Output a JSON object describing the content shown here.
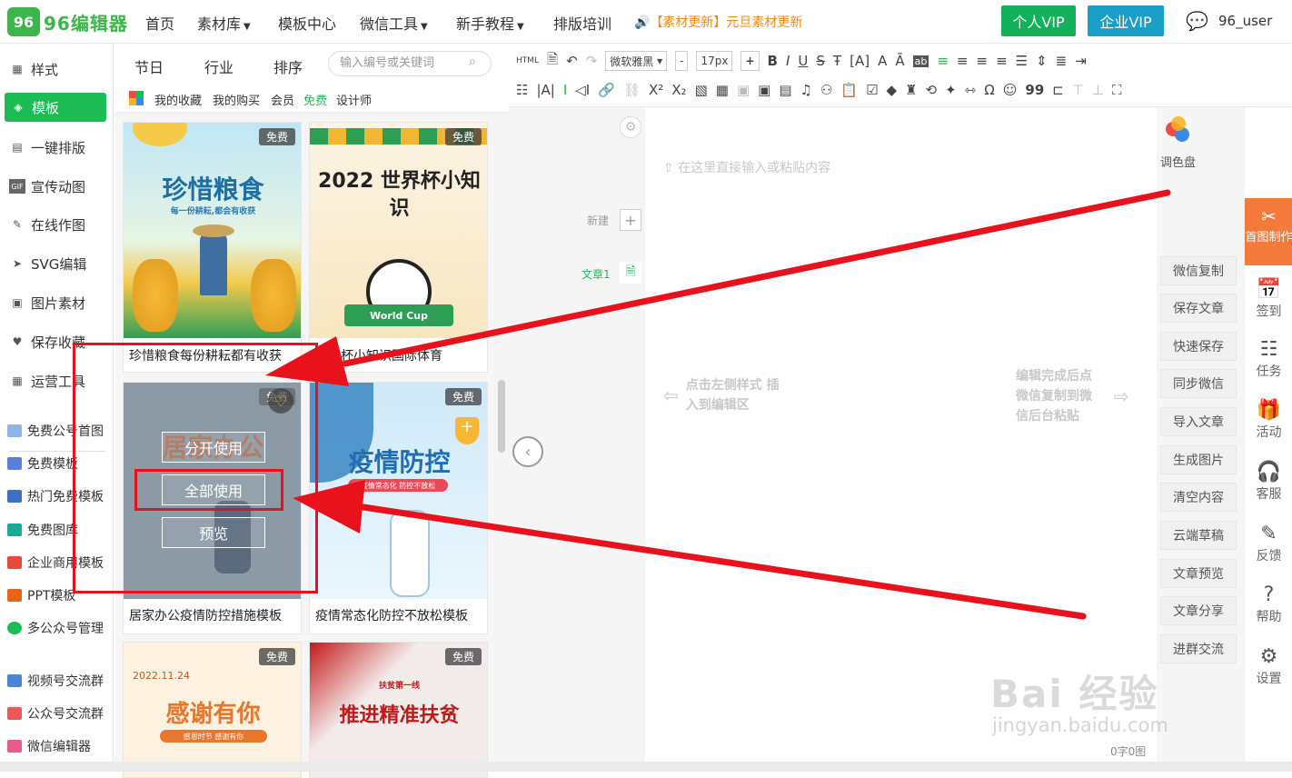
{
  "nav": {
    "logo_mark": "96",
    "logo_text": "96编辑器",
    "items": [
      "首页",
      "素材库",
      "模板中心",
      "微信工具",
      "新手教程",
      "排版培训"
    ],
    "notice": "【素材更新】元旦素材更新",
    "vip_personal": "个人VIP",
    "vip_business": "企业VIP",
    "username": "96_user"
  },
  "sidebar": {
    "primary": [
      "样式",
      "模板",
      "一键排版",
      "宣传动图",
      "在线作图",
      "SVG编辑",
      "图片素材",
      "保存收藏",
      "运营工具"
    ],
    "active": "模板",
    "secondary": [
      "免费公号首图",
      "免费模板",
      "热门免费模板",
      "免费图库",
      "企业商用模板",
      "PPT模板",
      "多公众号管理"
    ],
    "groups": [
      "视频号交流群",
      "公众号交流群",
      "微信编辑器"
    ]
  },
  "panel": {
    "tabs": [
      "节日",
      "行业",
      "排序"
    ],
    "search_placeholder": "输入编号或关键词",
    "filters": [
      "我的收藏",
      "我的购买",
      "会员",
      "免费",
      "设计师"
    ],
    "active_filter": "免费",
    "cards": [
      {
        "badge": "免费",
        "title": "珍惜粮食",
        "subtitle": "每一份耕耘,都会有收获",
        "caption": "珍惜粮食每份耕耘都有收获"
      },
      {
        "badge": "免费",
        "title": "2022 世界杯小知识",
        "subtitle": "World Cup",
        "caption": "世界杯小知识国际体育"
      },
      {
        "badge": "免费",
        "title": "居家办公",
        "caption": "居家办公疫情防控措施模板"
      },
      {
        "badge": "免费",
        "title": "疫情防控",
        "subtitle": "疫情常态化 防控不放松",
        "caption": "疫情常态化防控不放松模板"
      },
      {
        "badge": "免费",
        "title": "感谢有你",
        "date": "2022.11.24",
        "subtitle": "感恩时节 感谢有你"
      },
      {
        "badge": "免费",
        "title": "推进精准扶贫",
        "subtitle": "扶贫第一线"
      }
    ],
    "hover_actions": [
      "分开使用",
      "全部使用",
      "预览"
    ]
  },
  "editor": {
    "font": "微软雅黑",
    "font_size": "17px",
    "placeholder": "在这里直接输入或粘贴内容",
    "new_label": "新建",
    "article_label": "文章1",
    "hint_left": "点击左侧样式 插入到编辑区",
    "hint_right": "编辑完成后点 微信复制到微 信后台粘贴",
    "counter": "0字0图",
    "palette_label": "调色盘",
    "right_buttons": [
      "微信复制",
      "保存文章",
      "快速保存",
      "同步微信",
      "导入文章",
      "生成图片",
      "清空内容",
      "云端草稿",
      "文章预览",
      "文章分享",
      "进群交流"
    ],
    "far_right": [
      "首图制作",
      "签到",
      "任务",
      "活动",
      "客服",
      "反馈",
      "帮助",
      "设置"
    ]
  },
  "watermark": {
    "main": "Bai 经验",
    "sub": "jingyan.baidu.com"
  },
  "colors": {
    "green": "#1cbc55",
    "vip_green": "#13b25a",
    "vip_blue": "#1aa0c8",
    "annotation_red": "#e8121d",
    "orange": "#f47a3c"
  }
}
